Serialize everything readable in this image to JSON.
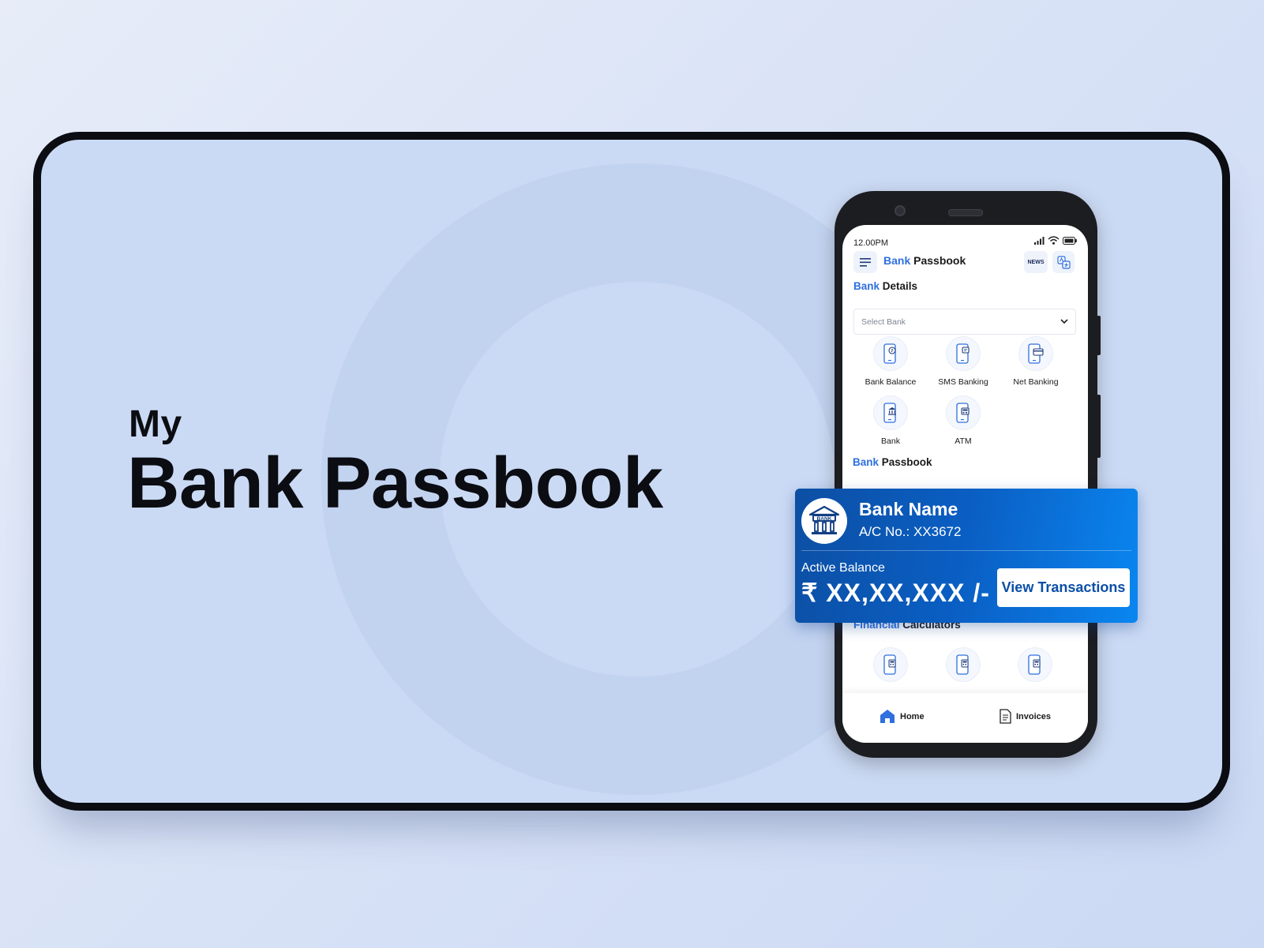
{
  "hero": {
    "prefix": "My",
    "title": "Bank Passbook"
  },
  "status": {
    "time": "12.00PM"
  },
  "header": {
    "title_accent": "Bank",
    "title_rest": " Passbook",
    "news_label": "NEWS"
  },
  "bank_details": {
    "title_accent": "Bank",
    "title_rest": " Details",
    "select_placeholder": "Select Bank",
    "services": [
      {
        "label": "Bank Balance",
        "icon": "phone-balance-icon"
      },
      {
        "label": "SMS Banking",
        "icon": "phone-sms-icon"
      },
      {
        "label": "Net Banking",
        "icon": "phone-card-icon"
      },
      {
        "label": "Bank",
        "icon": "phone-bank-icon"
      },
      {
        "label": "ATM",
        "icon": "phone-atm-icon"
      }
    ]
  },
  "passbook": {
    "title_accent": "Bank",
    "title_rest": " Passbook",
    "card": {
      "bank_name": "Bank Name",
      "account": "A/C No.: XX3672",
      "logo_text": "BANK",
      "balance_label": "Active Balance",
      "balance_value": "₹ XX,XX,XXX /-",
      "cta": "View Transactions"
    }
  },
  "calculators": {
    "title_accent": "Financial",
    "title_rest": " Calculators"
  },
  "bottom_nav": {
    "home": "Home",
    "invoices": "Invoices"
  },
  "colors": {
    "accent": "#2f6fde",
    "card_start": "#0c4fa4",
    "card_end": "#0a86f0",
    "background": "#cbdaf4"
  }
}
